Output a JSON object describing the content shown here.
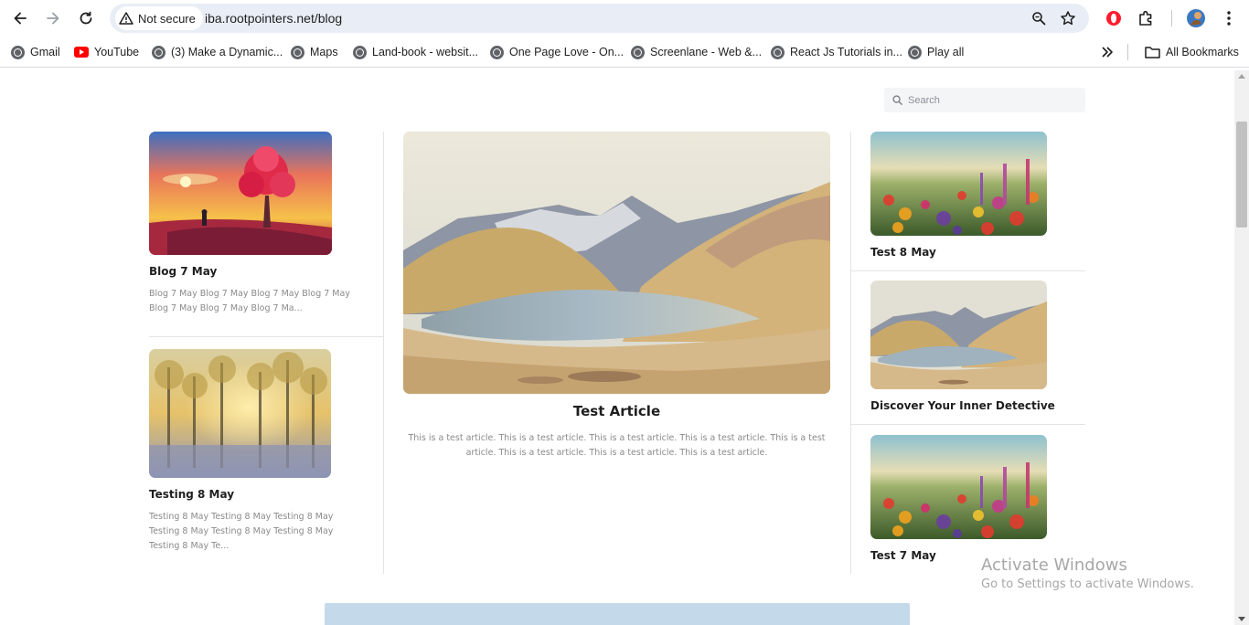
{
  "browser": {
    "security_label": "Not secure",
    "url": "iba.rootpointers.net/blog",
    "bookmarks": [
      {
        "label": "Gmail",
        "icon": "globe-icon"
      },
      {
        "label": "YouTube",
        "icon": "youtube-icon"
      },
      {
        "label": "(3) Make a Dynamic...",
        "icon": "globe-icon"
      },
      {
        "label": "Maps",
        "icon": "globe-icon"
      },
      {
        "label": "Land-book - websit...",
        "icon": "globe-icon"
      },
      {
        "label": "One Page Love - On...",
        "icon": "globe-icon"
      },
      {
        "label": "Screenlane - Web &...",
        "icon": "globe-icon"
      },
      {
        "label": "React Js Tutorials in...",
        "icon": "globe-icon"
      },
      {
        "label": "Play all",
        "icon": "globe-icon"
      }
    ],
    "all_bookmarks_label": "All Bookmarks"
  },
  "page": {
    "search_placeholder": "Search",
    "left_posts": [
      {
        "title": "Blog 7 May",
        "excerpt": "Blog 7 May Blog 7 May Blog 7 May Blog 7 May Blog 7 May Blog 7 May Blog 7 Ma..."
      },
      {
        "title": "Testing 8 May",
        "excerpt": "Testing 8 May Testing 8 May Testing 8 May Testing 8 May Testing 8 May Testing 8 May Testing 8 May Te..."
      }
    ],
    "featured": {
      "title": "Test Article",
      "excerpt": "This is a test article. This is a test article. This is a test article. This is a test article. This is a test article. This is a test article. This is a test article. This is a test article."
    },
    "right_posts": [
      {
        "title": "Test 8 May"
      },
      {
        "title": "Discover Your Inner Detective"
      },
      {
        "title": "Test 7 May"
      }
    ]
  },
  "os_overlay": {
    "line1": "Activate Windows",
    "line2": "Go to Settings to activate Windows."
  },
  "colors": {
    "omnibox": "#e9eef6",
    "banner": "#c4d9ea",
    "opera_red": "#ff1b2d"
  }
}
